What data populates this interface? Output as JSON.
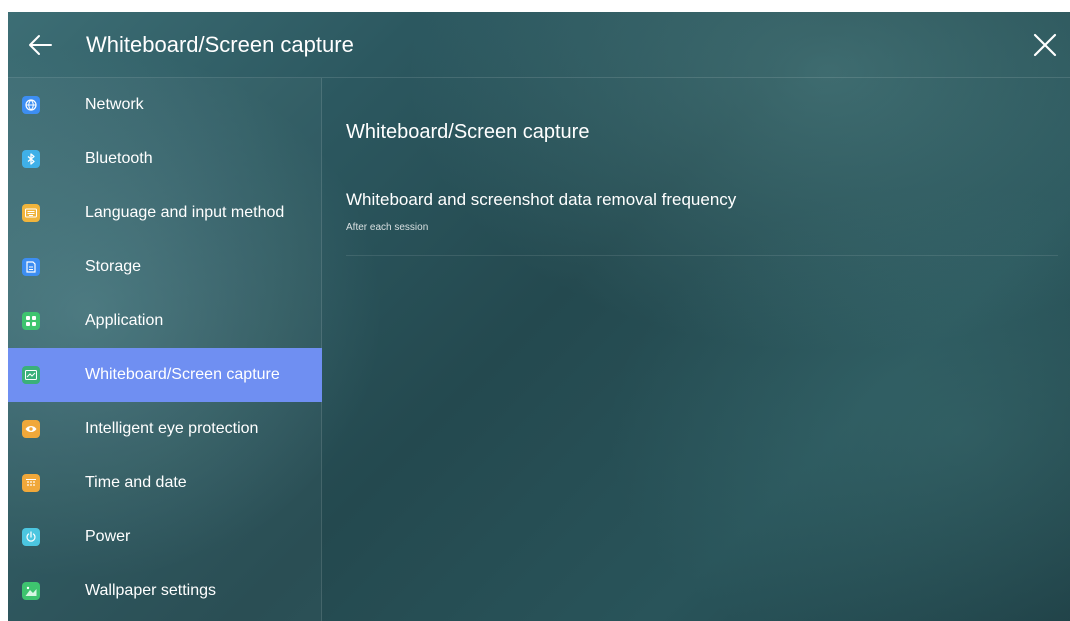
{
  "header": {
    "title": "Whiteboard/Screen capture",
    "back_icon": "arrow-left-icon",
    "close_icon": "close-icon"
  },
  "sidebar": {
    "items": [
      {
        "label": "Network",
        "icon": "globe-icon",
        "color": "#3d8ef2",
        "active": false
      },
      {
        "label": "Bluetooth",
        "icon": "bluetooth-icon",
        "color": "#3fb0e8",
        "active": false
      },
      {
        "label": "Language and input method",
        "icon": "keyboard-icon",
        "color": "#f0b43c",
        "active": false
      },
      {
        "label": "Storage",
        "icon": "storage-icon",
        "color": "#3d8ef2",
        "active": false
      },
      {
        "label": "Application",
        "icon": "apps-grid-icon",
        "color": "#3ec46f",
        "active": false
      },
      {
        "label": "Whiteboard/Screen capture",
        "icon": "screen-capture-icon",
        "color": "#3ab07a",
        "active": true
      },
      {
        "label": "Intelligent eye protection",
        "icon": "eye-icon",
        "color": "#f0a83a",
        "active": false
      },
      {
        "label": "Time and date",
        "icon": "calendar-icon",
        "color": "#f0a83a",
        "active": false
      },
      {
        "label": "Power",
        "icon": "power-icon",
        "color": "#4cc6e0",
        "active": false
      },
      {
        "label": "Wallpaper settings",
        "icon": "wallpaper-icon",
        "color": "#3ec46f",
        "active": false
      }
    ]
  },
  "content": {
    "title": "Whiteboard/Screen capture",
    "setting": {
      "title": "Whiteboard and screenshot data removal frequency",
      "value": "After each session"
    }
  },
  "colors": {
    "active_item": "#6f8ff2",
    "background": "#2c5860"
  }
}
